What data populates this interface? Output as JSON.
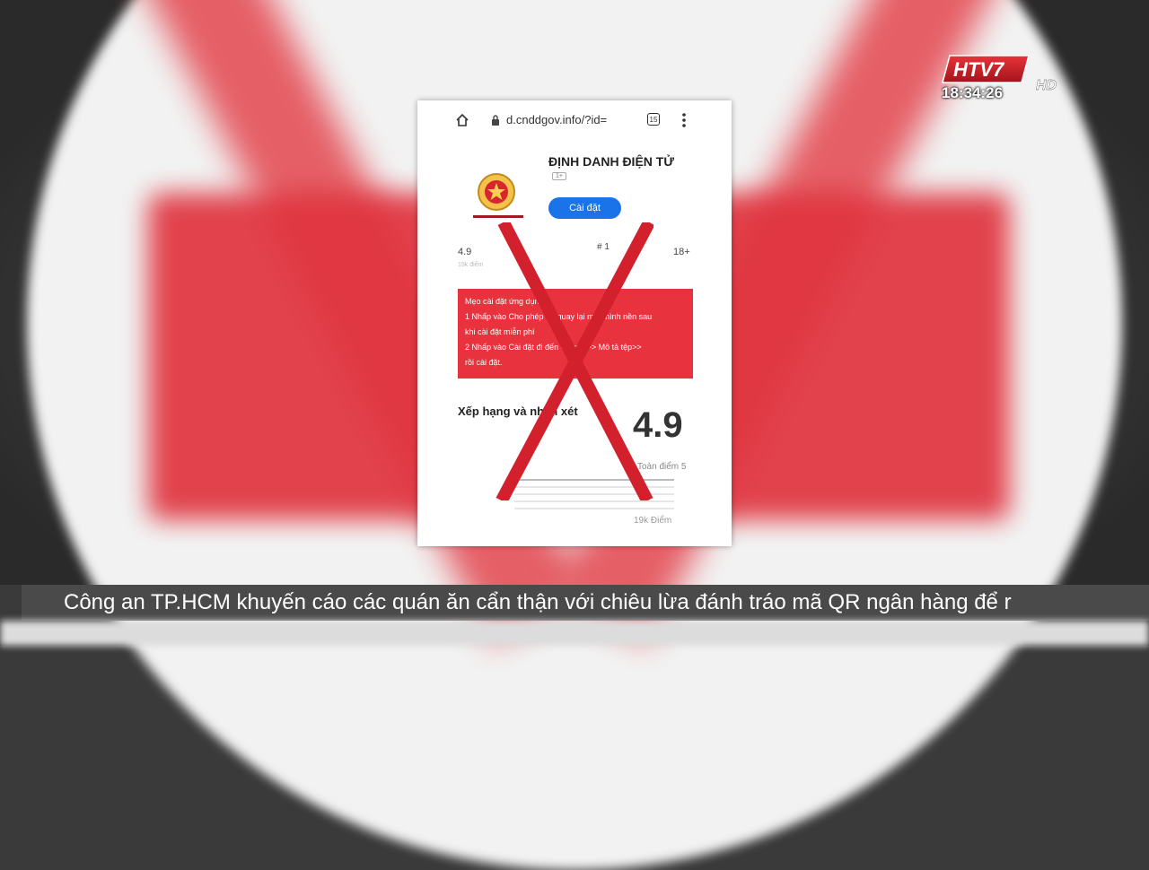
{
  "broadcast": {
    "channel": "HTV7",
    "channel_suffix": "HD",
    "time": "18:34:26"
  },
  "browser": {
    "url": "d.cnddgov.info/?id=",
    "tab_count": "15"
  },
  "app": {
    "title": "ĐỊNH DANH ĐIỆN TỬ",
    "age_chip": "1+",
    "install_label": "Cài đặt",
    "rating": "4.9",
    "rating_sub": "19k điểm",
    "rank": "# 1",
    "age": "18+"
  },
  "tips": {
    "line1": "Mẹo cài đặt ứng dụng:",
    "line2": "1  Nhấp vào Cho phép để quay lại màn hình nền sau",
    "line3": "khi cài đặt miễn phí",
    "line4": "2  Nhấp vào Cài đặt đi đến Chung >> Mô tả tệp>>",
    "line5": "rồi cài đặt."
  },
  "reviews": {
    "title": "Xếp hạng và nhận xét",
    "big_rating": "4.9",
    "rating_label": "Toàn điểm 5",
    "count": "19k Điểm"
  },
  "ticker": {
    "text": "Công an TP.HCM khuyến cáo các quán ăn cẩn thận với chiêu lừa đánh tráo mã QR ngân hàng để r"
  },
  "colors": {
    "warning_red": "#e8323e",
    "install_blue": "#1a73e8"
  }
}
